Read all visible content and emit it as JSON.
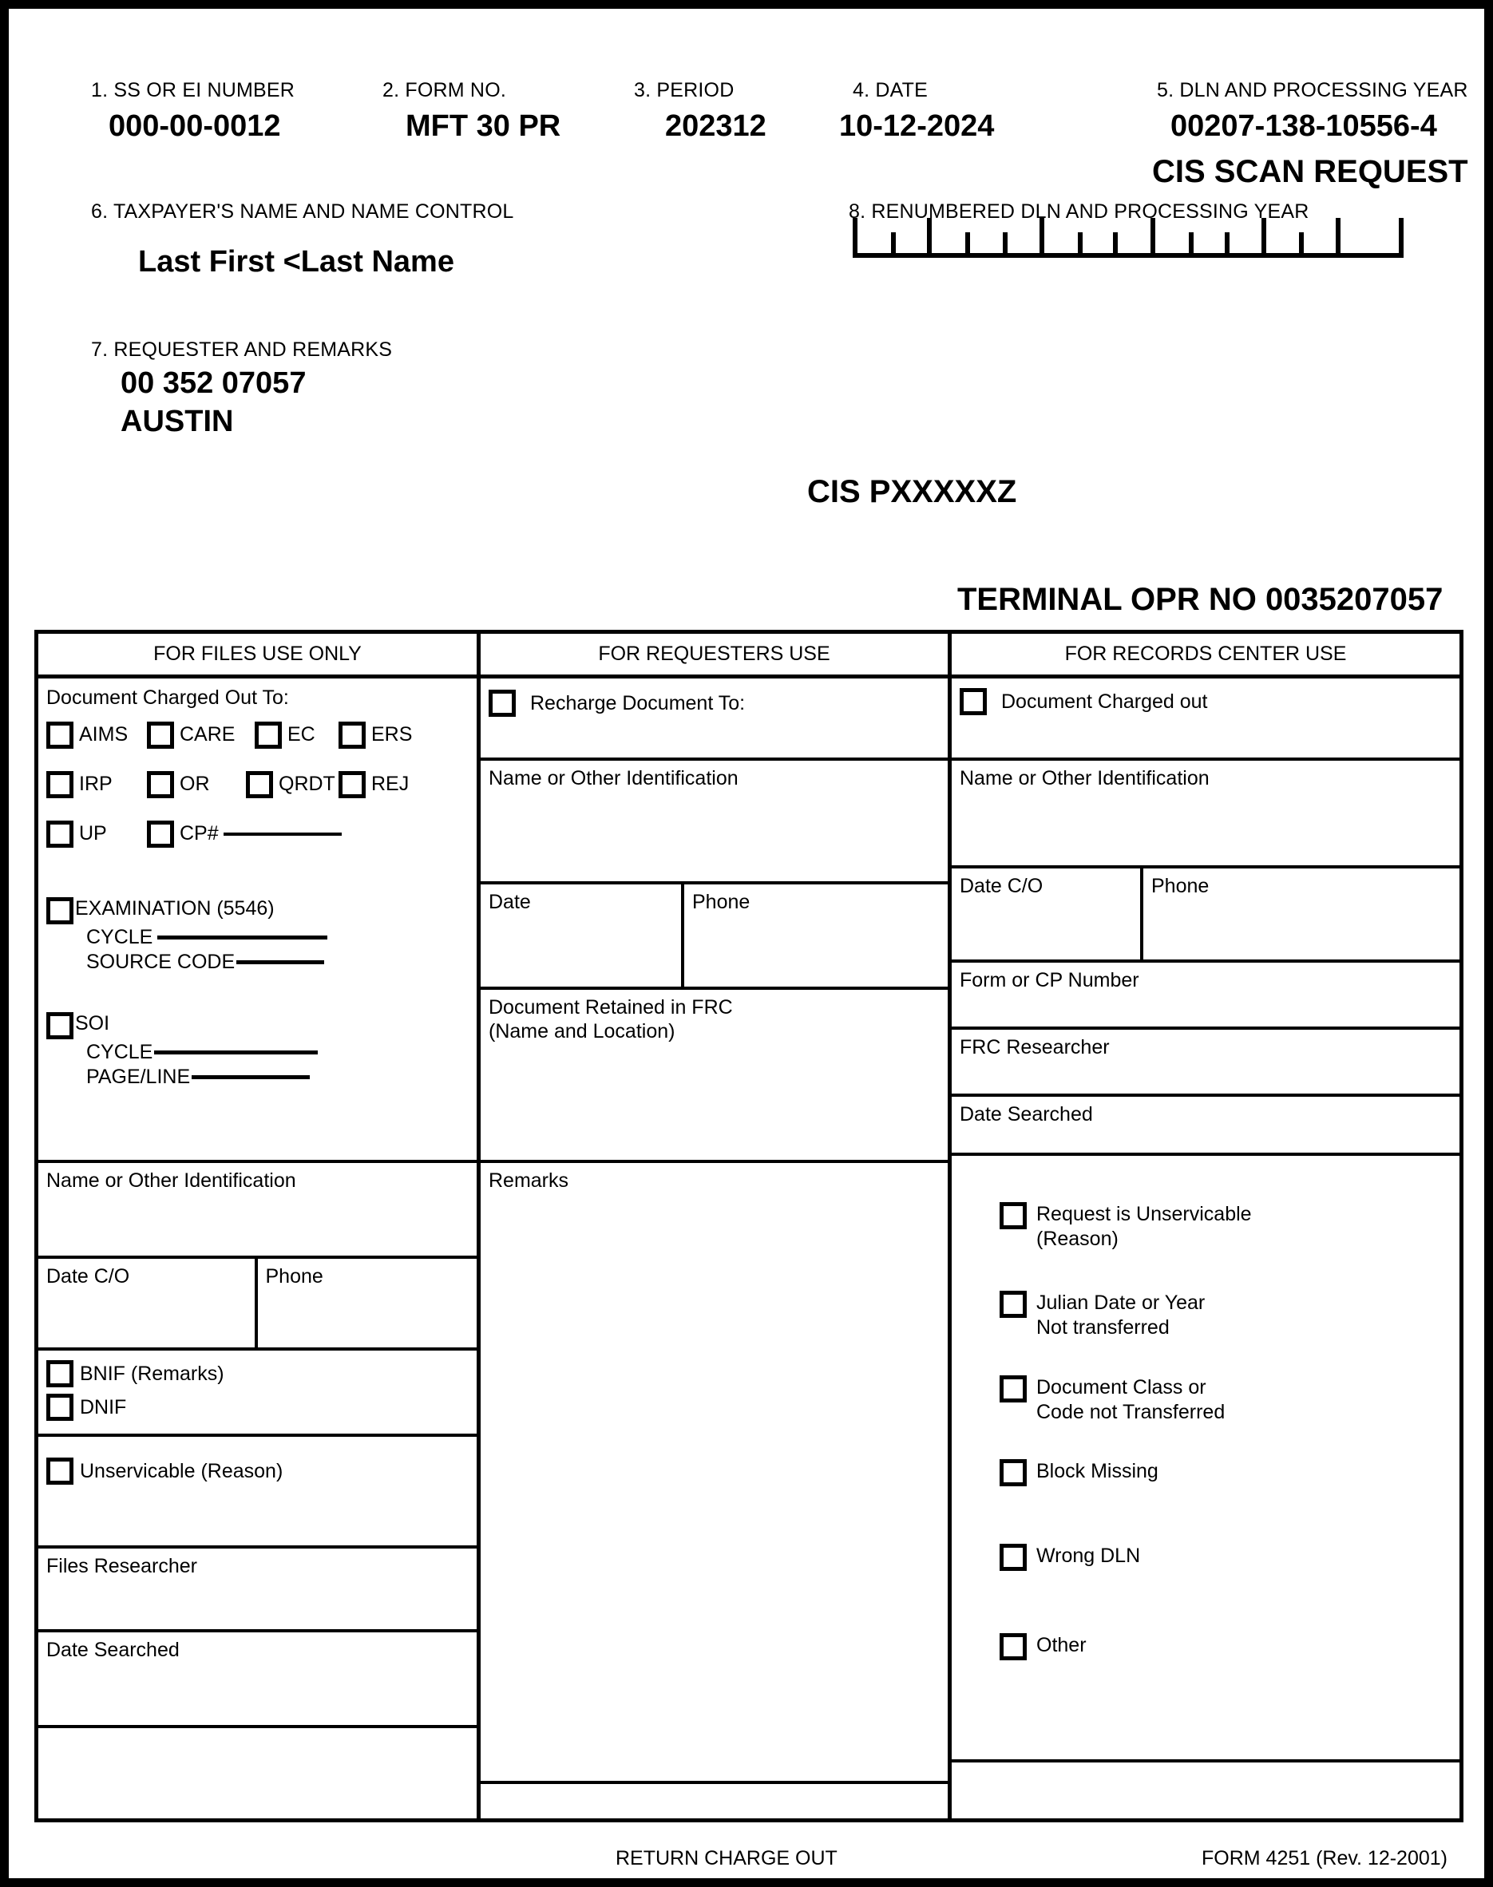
{
  "header": {
    "fields": [
      {
        "label": "1.  SS OR EI NUMBER",
        "value": "000-00-0012"
      },
      {
        "label": "2.  FORM NO.",
        "value": "MFT 30 PR"
      },
      {
        "label": "3.  PERIOD",
        "value": "202312"
      },
      {
        "label": "4.  DATE",
        "value": "10-12-2024"
      },
      {
        "label": "5.  DLN AND PROCESSING YEAR",
        "value": "00207-138-10556-4"
      }
    ],
    "scan_request_title": "CIS SCAN REQUEST",
    "taxpayer_name_label": "6.  TAXPAYER'S NAME AND NAME CONTROL",
    "taxpayer_name_value": "Last First <Last Name",
    "renumbered_dln_label": "8.  RENUMBERED DLN AND PROCESSING YEAR",
    "requester_label": "7.  REQUESTER AND REMARKS",
    "requester_line1": "00 352 07057",
    "requester_line2": "AUSTIN",
    "cis_case_id": "CIS PXXXXXZ",
    "terminal_opr": "TERMINAL OPR NO 0035207057"
  },
  "grid": {
    "col_titles": {
      "files": "FOR FILES USE ONLY",
      "requesters": "FOR REQUESTERS USE",
      "records": "FOR RECORDS CENTER USE"
    },
    "files": {
      "charged_out_to_label": "Document Charged Out To:",
      "charge_row1": [
        "AIMS",
        "CARE",
        "EC",
        "ERS"
      ],
      "charge_row2": [
        "IRP",
        "OR",
        "QRDT",
        "REJ"
      ],
      "charge_row3": [
        "UP",
        "CP#"
      ],
      "examination_label": "EXAMINATION (5546)",
      "examination_cycle_label": "CYCLE",
      "examination_source_code_label": "SOURCE CODE",
      "soi_label": "SOI",
      "soi_cycle_label": "CYCLE",
      "soi_page_line_label": "PAGE/LINE",
      "name_or_other_id_label": "Name or Other Identification",
      "date_co_label": "Date C/O",
      "phone_label": "Phone",
      "bnif_label": "BNIF (Remarks)",
      "dnif_label": "DNIF",
      "unservicable_label": "Unservicable (Reason)",
      "files_researcher_label": "Files Researcher",
      "date_searched_label": "Date Searched"
    },
    "requesters": {
      "recharge_label": "Recharge Document To:",
      "name_or_other_id_label": "Name or Other Identification",
      "date_label": "Date",
      "phone_label": "Phone",
      "document_retained_line1": "Document Retained in FRC",
      "document_retained_line2": "(Name and Location)",
      "remarks_label": "Remarks"
    },
    "records": {
      "document_charged_out_label": "Document Charged out",
      "name_or_other_id_label": "Name or Other Identification",
      "date_co_label": "Date C/O",
      "phone_label": "Phone",
      "form_or_cp_number_label": "Form or CP Number",
      "frc_researcher_label": "FRC Researcher",
      "date_searched_label": "Date Searched",
      "reasons": [
        {
          "line1": "Request is Unservicable",
          "line2": "(Reason)"
        },
        {
          "line1": "Julian Date or Year",
          "line2": "Not transferred"
        },
        {
          "line1": "Document Class or",
          "line2": "Code not Transferred"
        },
        {
          "line1": "Block Missing",
          "line2": ""
        },
        {
          "line1": "Wrong DLN",
          "line2": ""
        },
        {
          "line1": "Other",
          "line2": ""
        }
      ]
    }
  },
  "footer": {
    "return_charge_out": "RETURN CHARGE OUT",
    "form_number": "FORM 4251 (Rev. 12-2001)"
  }
}
